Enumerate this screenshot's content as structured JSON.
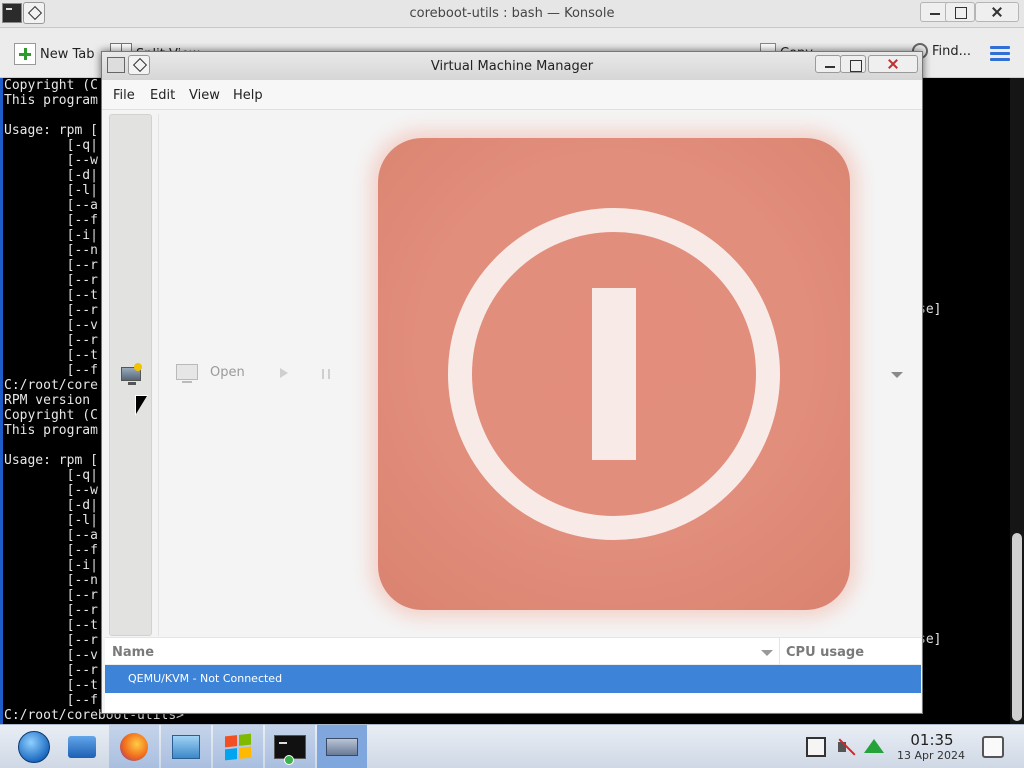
{
  "konsole": {
    "title": "coreboot-utils : bash — Konsole",
    "toolbar": {
      "new_tab": "New Tab",
      "split_view": "Split View",
      "copy": "Copy",
      "find": "Find..."
    },
    "terminal_lines": [
      "Copyright (C",
      "This program",
      "",
      "Usage: rpm [",
      "        [-q|",
      "        [--w",
      "        [-d|",
      "        [-l|",
      "        [--a",
      "        [--f",
      "        [-i|",
      "        [--n",
      "        [--r",
      "        [--r",
      "        [--t",
      "        [--r",
      "        [--v",
      "        [--r",
      "        [--t",
      "        [--f",
      "C:/root/core",
      "RPM version",
      "Copyright (C",
      "This program",
      "",
      "Usage: rpm [",
      "        [-q|",
      "        [--w",
      "        [-d|",
      "        [-l|",
      "        [--a",
      "        [--f",
      "        [-i|",
      "        [--n",
      "        [--r",
      "        [--r",
      "        [--t",
      "        [--r",
      "        [--v",
      "        [--r",
      "        [--t",
      "        [--f",
      "C:/root/coreboot-utils>"
    ],
    "right_fragment_1": "se]",
    "right_fragment_2": "se]"
  },
  "vmm": {
    "title": "Virtual Machine Manager",
    "menu": [
      "File",
      "Edit",
      "View",
      "Help"
    ],
    "toolbar": {
      "open_label": "Open"
    },
    "list": {
      "columns": [
        "Name",
        "CPU usage"
      ],
      "rows": [
        {
          "name": "QEMU/KVM - Not Connected",
          "selected": true
        }
      ]
    },
    "accent_color": "#3d84d9"
  },
  "taskbar": {
    "clock_time": "01:35",
    "clock_date": "13 Apr 2024"
  }
}
